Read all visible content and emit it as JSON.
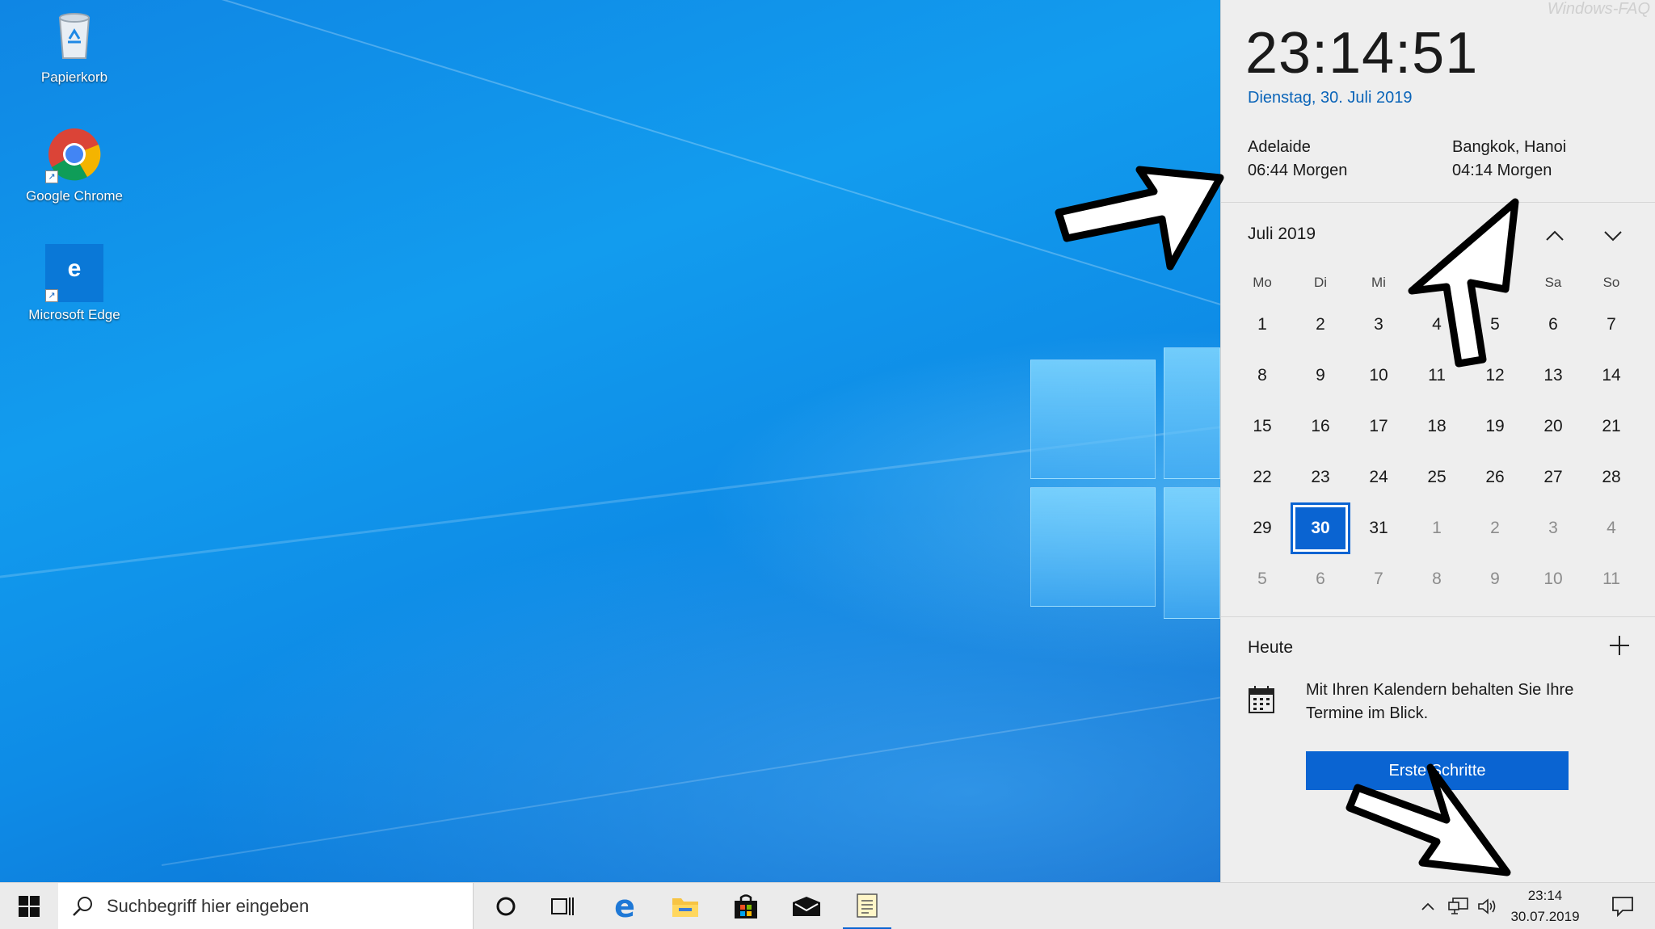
{
  "desktop": {
    "icons": [
      {
        "label": "Papierkorb",
        "icon": "recycle-bin-icon"
      },
      {
        "label": "Google Chrome",
        "icon": "chrome-icon"
      },
      {
        "label": "Microsoft Edge",
        "icon": "edge-icon"
      }
    ]
  },
  "flyout": {
    "watermark": "Windows-FAQ",
    "time": "23:14:51",
    "date": "Dienstag, 30. Juli 2019",
    "zones": [
      {
        "city": "Adelaide",
        "time": "06:44 Morgen"
      },
      {
        "city": "Bangkok, Hanoi",
        "time": "04:14 Morgen"
      }
    ],
    "calendar": {
      "month": "Juli 2019",
      "weekdays": [
        "Mo",
        "Di",
        "Mi",
        "Do",
        "Fr",
        "Sa",
        "So"
      ],
      "weeks": [
        [
          "1",
          "2",
          "3",
          "4",
          "5",
          "6",
          "7"
        ],
        [
          "8",
          "9",
          "10",
          "11",
          "12",
          "13",
          "14"
        ],
        [
          "15",
          "16",
          "17",
          "18",
          "19",
          "20",
          "21"
        ],
        [
          "22",
          "23",
          "24",
          "25",
          "26",
          "27",
          "28"
        ],
        [
          "29",
          "30",
          "31",
          "1",
          "2",
          "3",
          "4"
        ],
        [
          "5",
          "6",
          "7",
          "8",
          "9",
          "10",
          "11"
        ]
      ],
      "today": "30"
    },
    "agenda": {
      "heading": "Heute",
      "hint": "Mit Ihren Kalendern behalten Sie Ihre Termine im Blick.",
      "button": "Erste Schritte"
    }
  },
  "taskbar": {
    "search_placeholder": "Suchbegriff hier eingeben",
    "clock_time": "23:14",
    "clock_date": "30.07.2019"
  },
  "colors": {
    "accent": "#0a64d2",
    "date_text": "#0a64b8"
  }
}
